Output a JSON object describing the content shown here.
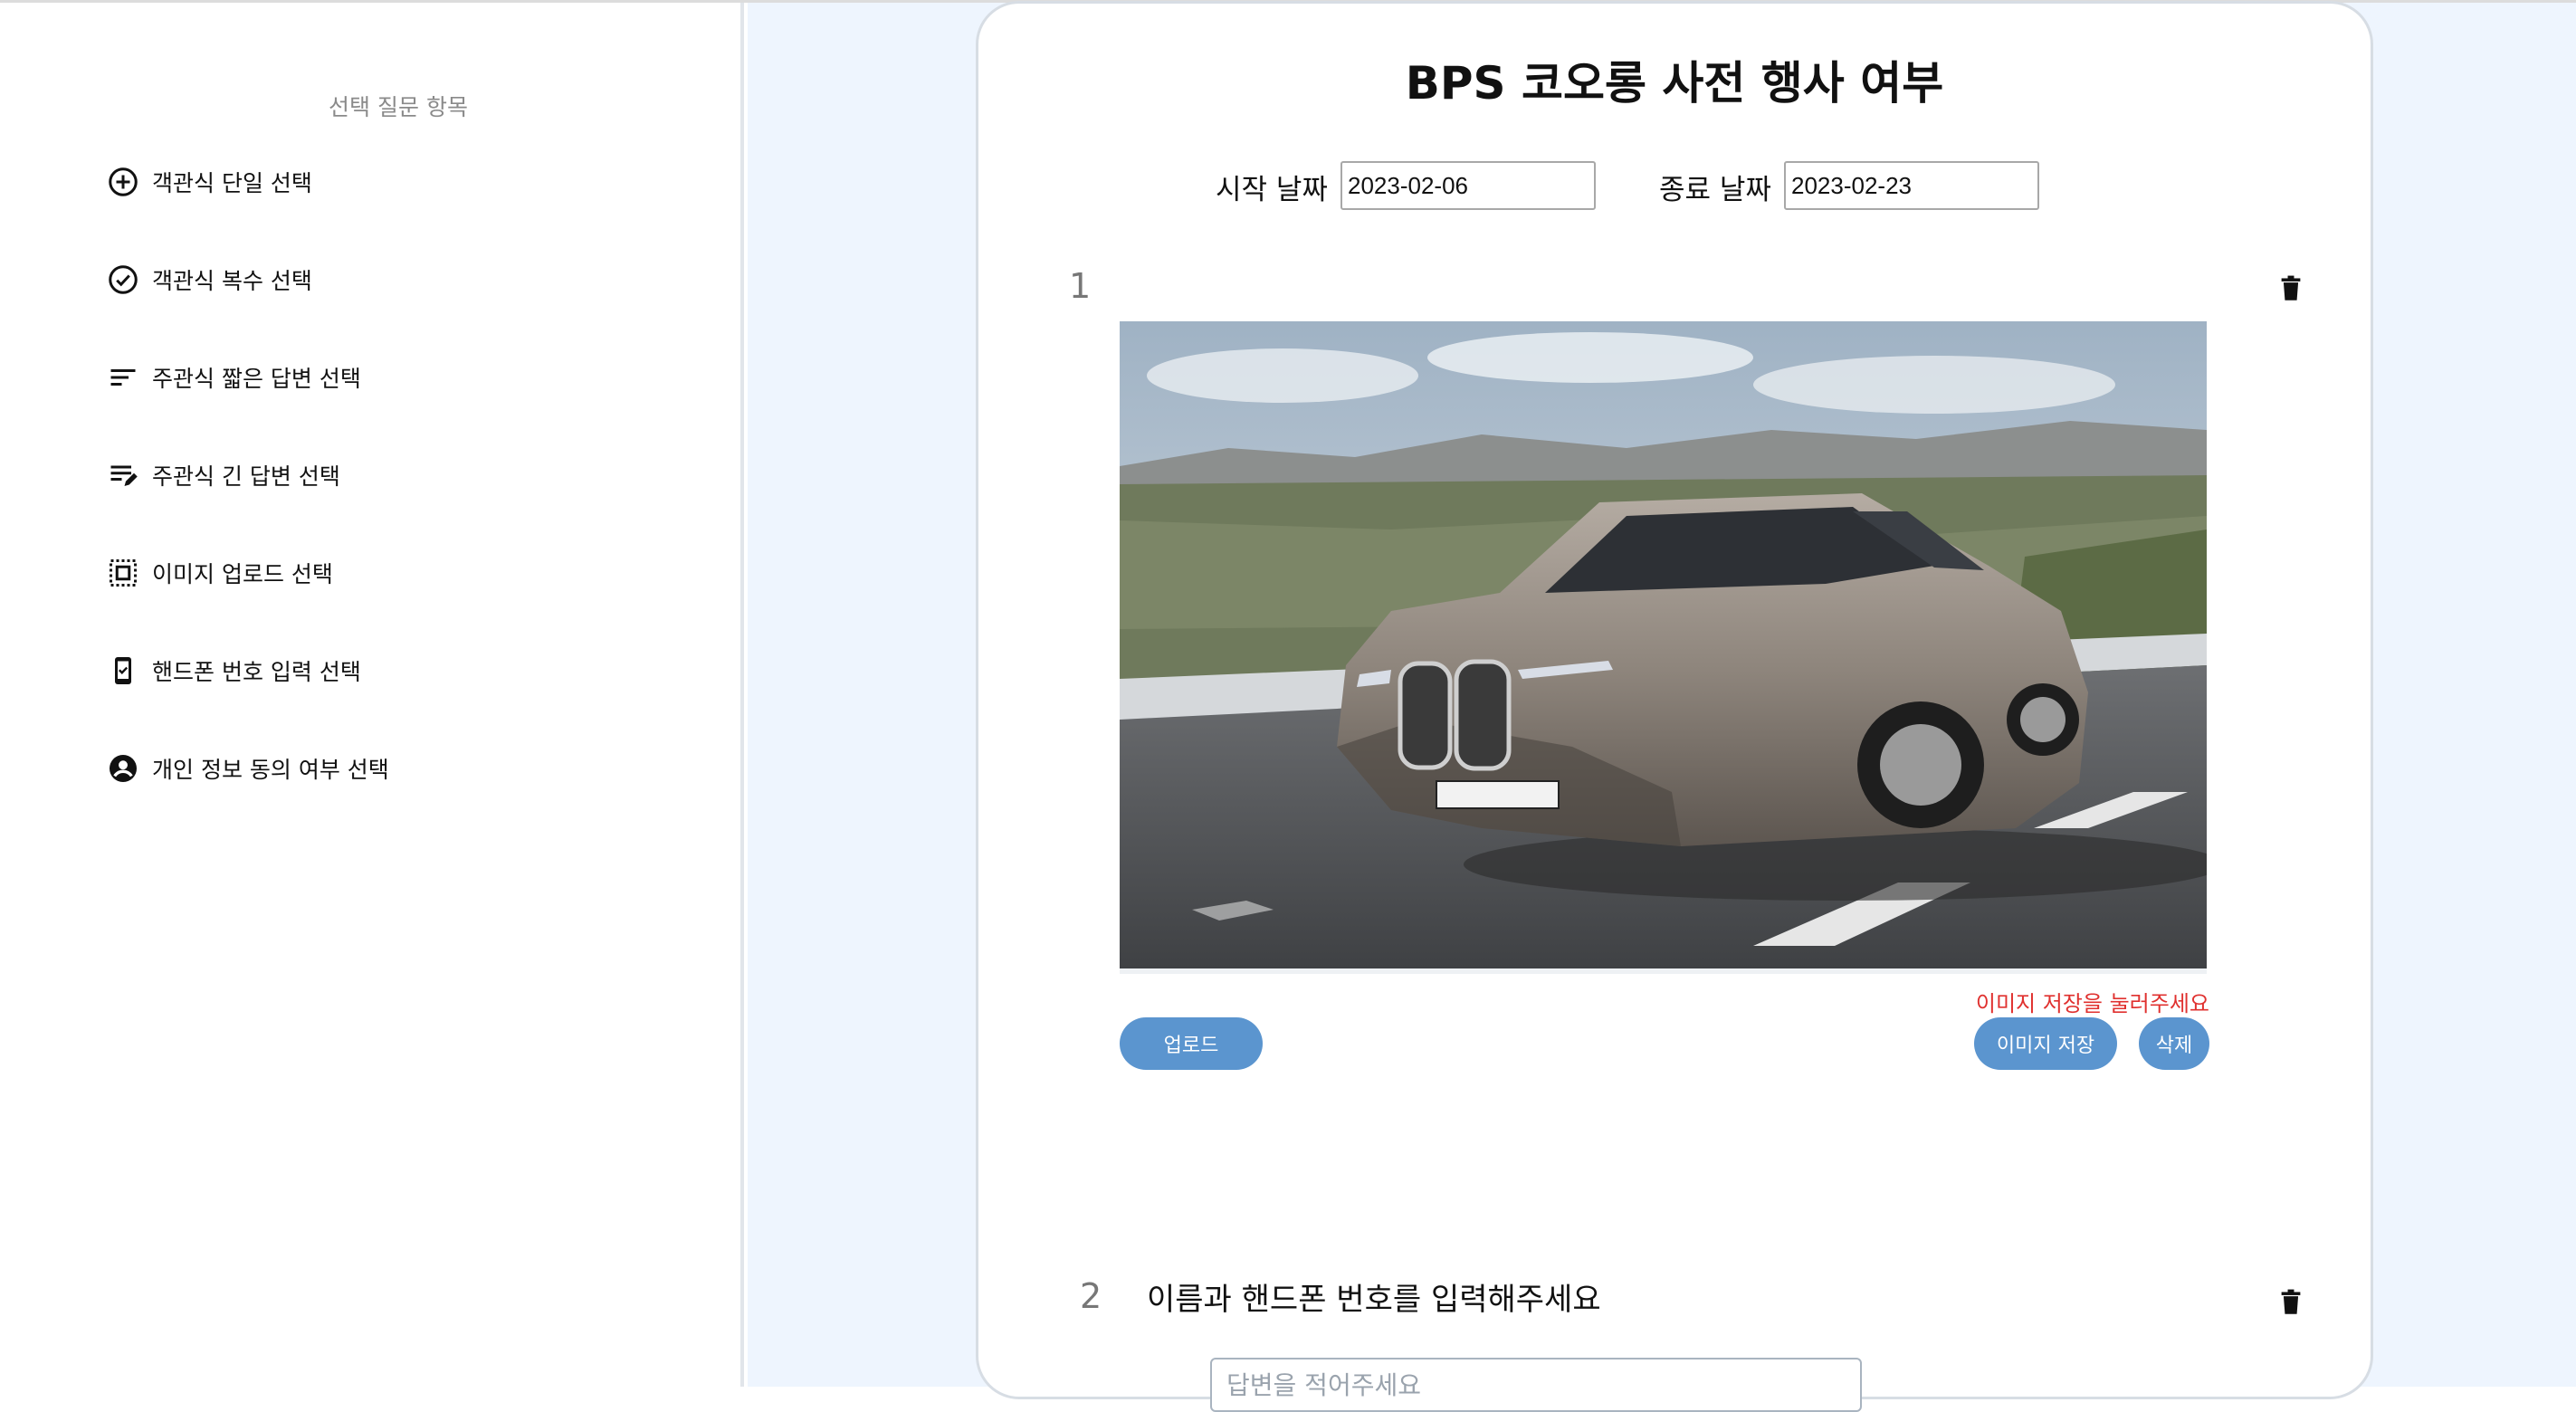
{
  "sidebar": {
    "title": "선택 질문 항목",
    "items": [
      {
        "label": "객관식 단일 선택",
        "icon": "plus-circle-icon"
      },
      {
        "label": "객관식 복수 선택",
        "icon": "check-circle-icon"
      },
      {
        "label": "주관식 짧은 답변 선택",
        "icon": "short-text-icon"
      },
      {
        "label": "주관식 긴 답변 선택",
        "icon": "long-text-edit-icon"
      },
      {
        "label": "이미지 업로드 선택",
        "icon": "image-select-icon"
      },
      {
        "label": "핸드폰 번호 입력 선택",
        "icon": "phone-check-icon"
      },
      {
        "label": "개인 정보 동의 여부 선택",
        "icon": "account-circle-icon"
      }
    ]
  },
  "form": {
    "title": "BPS 코오롱 사전 행사 여부",
    "start_label": "시작 날짜",
    "start_value": "2023-02-06",
    "end_label": "종료 날짜",
    "end_value": "2023-02-23"
  },
  "questions": [
    {
      "number": "1",
      "warning": "이미지 저장을 눌러주세요",
      "upload_label": "업로드",
      "save_image_label": "이미지 저장",
      "delete_label": "삭제"
    },
    {
      "number": "2",
      "text": "이름과 핸드폰 번호를 입력해주세요",
      "placeholder": "답변을 적어주세요"
    }
  ],
  "colors": {
    "button": "#5b95cf",
    "warning": "#e0312f",
    "main_bg": "#eef5fe"
  }
}
